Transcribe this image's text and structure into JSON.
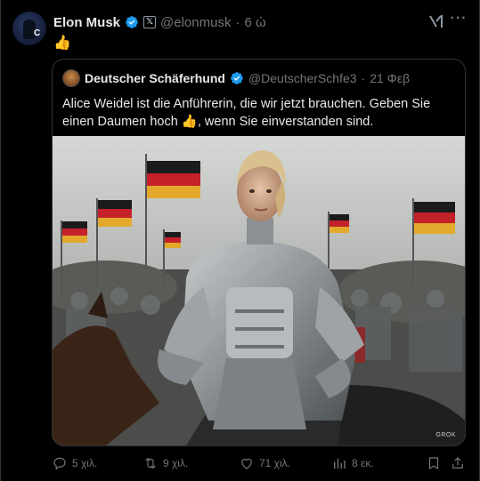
{
  "post": {
    "author_name": "Elon Musk",
    "author_handle": "@elonmusk",
    "separator": "·",
    "time": "6 ώ",
    "body_emoji": "👍"
  },
  "quoted": {
    "author_name": "Deutscher Schäferhund",
    "author_handle": "@DeutscherSchfe3",
    "separator": "·",
    "time": "21 Φεβ",
    "text": "Alice Weidel ist die Anführerin, die wir jetzt brauchen. Geben Sie einen Daumen hoch 👍, wenn Sie einverstanden sind.",
    "image_watermark": "GROK"
  },
  "actions": {
    "replies": "5 χιλ.",
    "reposts": "9 χιλ.",
    "likes": "71 χιλ.",
    "views": "8 εκ."
  },
  "icons": [
    "verified-icon",
    "x-affiliate-badge-icon",
    "grok-icon",
    "more-icon",
    "reply-icon",
    "repost-icon",
    "like-icon",
    "views-icon",
    "bookmark-icon",
    "share-icon"
  ],
  "colors": {
    "background": "#000000",
    "text": "#e7e9ea",
    "muted": "#71767b",
    "verified": "#1d9bf0",
    "border": "#2f3336"
  }
}
